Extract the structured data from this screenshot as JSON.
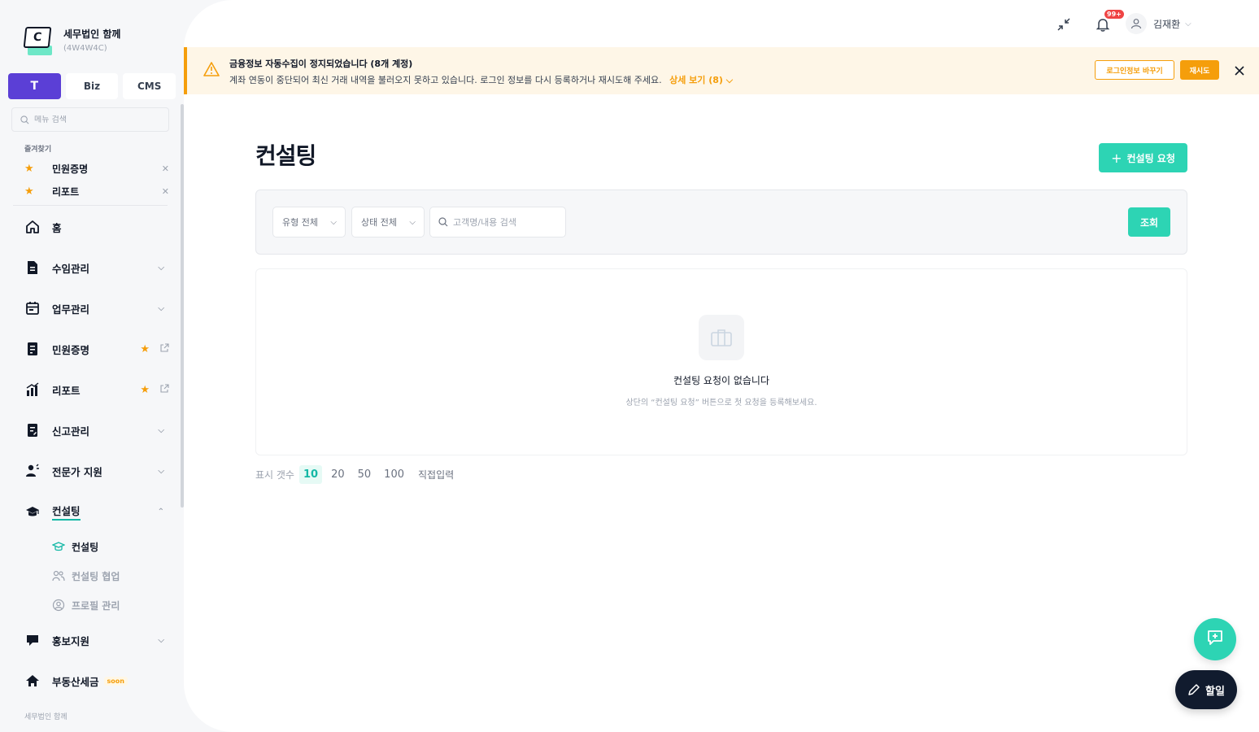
{
  "brand": {
    "name": "세무법인 함께",
    "code": "(4W4W4C)",
    "logo_letter": "C"
  },
  "mode_tabs": [
    {
      "label": "T",
      "active": true
    },
    {
      "label": "Biz",
      "active": false
    },
    {
      "label": "CMS",
      "active": false
    }
  ],
  "menu_search": {
    "placeholder": "메뉴 검색"
  },
  "favorites": {
    "title": "즐겨찾기",
    "items": [
      {
        "label": "민원증명"
      },
      {
        "label": "리포트"
      }
    ]
  },
  "nav": {
    "home": "홈",
    "fee": "수임관리",
    "work": "업무관리",
    "civil": "민원증명",
    "report": "리포트",
    "filing": "신고관리",
    "expert": "전문가 지원",
    "consulting": "컨설팅",
    "consulting_sub": [
      "컨설팅",
      "컨설팅 협업",
      "프로필 관리"
    ],
    "promo": "홍보지원",
    "realestate": "부동산세금",
    "realestate_badge": "soon"
  },
  "sidebar_footer": "세무법인 함께",
  "topbar": {
    "badge": "99+",
    "user_name": "김재환"
  },
  "alert": {
    "title": "금융정보 자동수집이 정지되었습니다 (8개 계정)",
    "description": "계좌 연동이 중단되어 최신 거래 내역을 불러오지 못하고 있습니다. 로그인 정보를 다시 등록하거나 재시도해 주세요.",
    "more_label": "상세 보기 (8)",
    "change_login_label": "로그인정보 바꾸기",
    "retry_label": "재시도"
  },
  "page": {
    "title": "컨설팅",
    "primary_action": "컨설팅 요청"
  },
  "filters": {
    "type_label": "유형 전체",
    "status_label": "상태 전체",
    "search_placeholder": "고객명/내용 검색",
    "query_label": "조회"
  },
  "empty": {
    "title": "컨설팅 요청이 없습니다",
    "description": "상단의 “컨설팅 요청” 버튼으로 첫 요청을 등록해보세요."
  },
  "page_size": {
    "label": "표시 갯수",
    "options": [
      "10",
      "20",
      "50",
      "100"
    ],
    "selected": "10",
    "direct": "직접입력"
  },
  "fab": {
    "todo_label": "할일"
  },
  "colors": {
    "accent": "#2dd4b4",
    "mode_active": "#5b3fd6",
    "warning": "#f59e0b",
    "dark": "#111b2e"
  }
}
